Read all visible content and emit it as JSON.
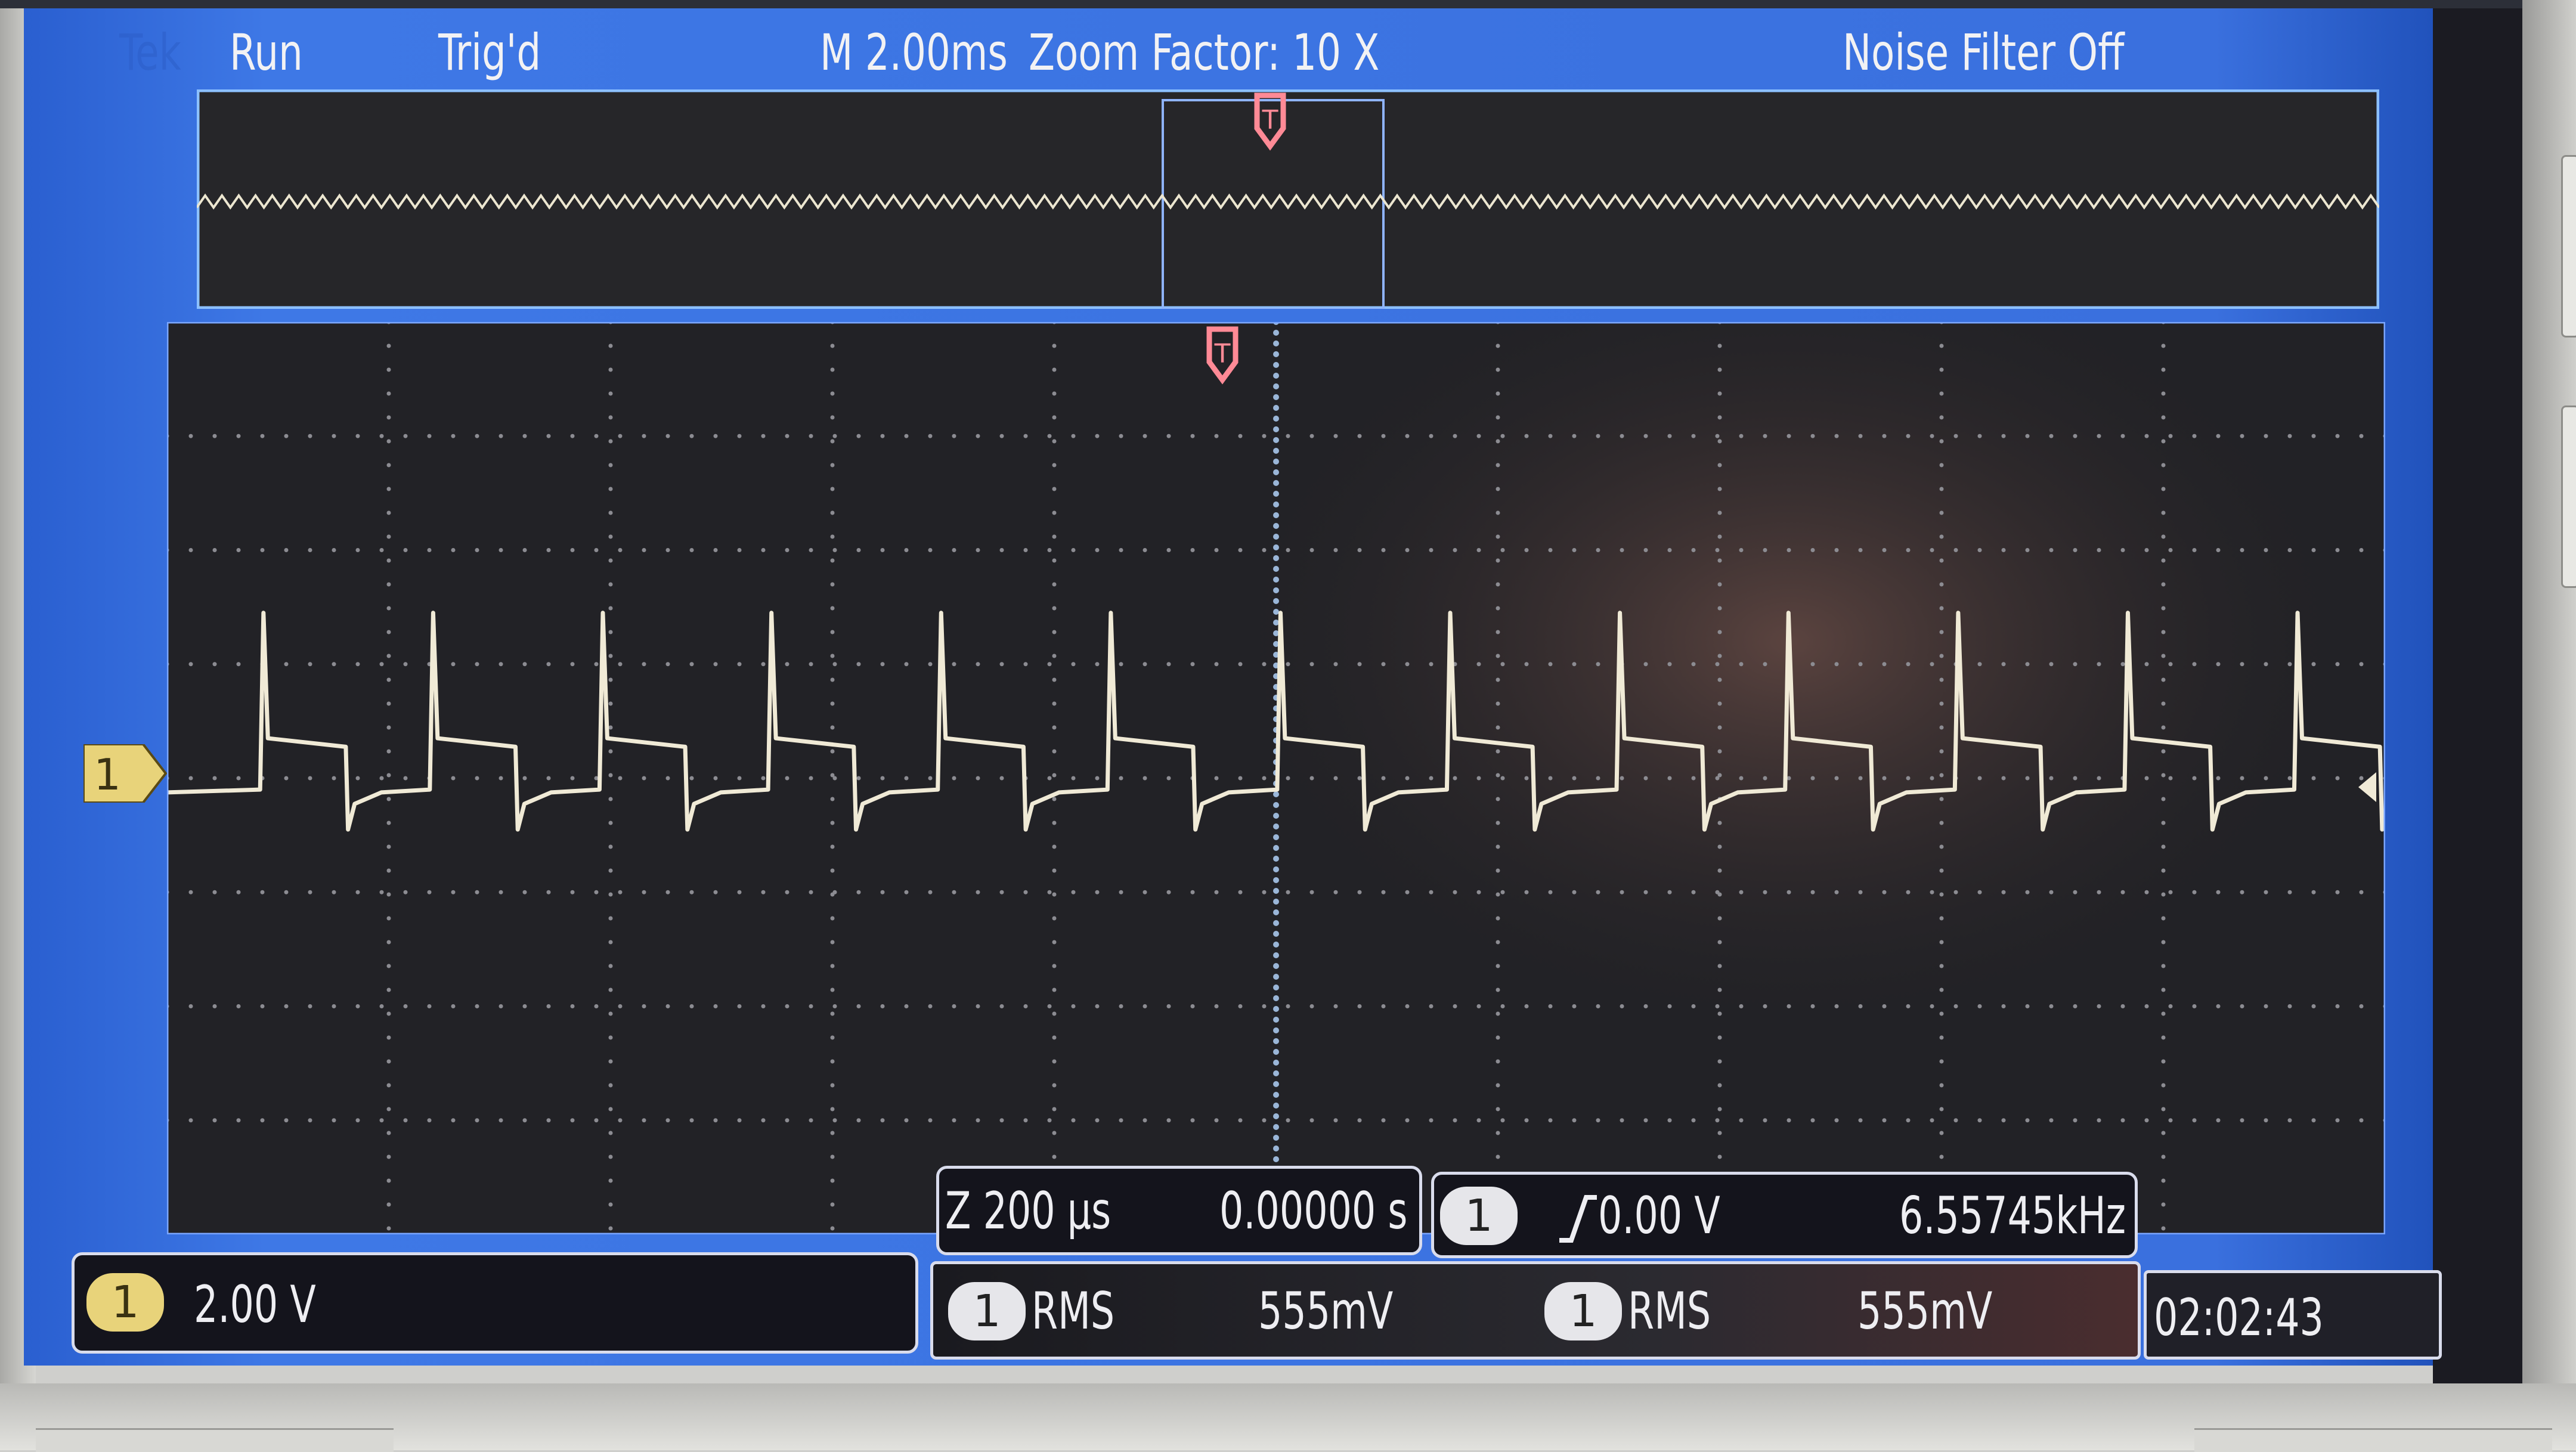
{
  "status_bar": {
    "brand": "Tek",
    "acq_state": "Run",
    "trigger_state": "Trig'd",
    "timebase": "M 2.00ms",
    "zoom": "Zoom Factor: 10 X",
    "noise_filter": "Noise Filter Off"
  },
  "channel1": {
    "marker": "1",
    "scale": "2.00 V",
    "trace_color": "#f0ead6"
  },
  "zoom_readout": {
    "scale": "Z 200 µs",
    "position": "0.00000 s"
  },
  "trigger_readout": {
    "source": "1",
    "slope_icon": "rising-edge-icon",
    "level": "0.00 V",
    "frequency": "6.55745kHz"
  },
  "measurements": [
    {
      "source": "1",
      "type": "RMS",
      "value": "555mV"
    },
    {
      "source": "1",
      "type": "RMS",
      "value": "555mV"
    }
  ],
  "clock": "02:02:43",
  "colors": {
    "screen_blue": "#3a70de",
    "graticule_bg": "#1f1f24",
    "trigger_marker": "#ff7f8c",
    "badge_yellow": "#e8d37a",
    "badge_white": "#e6e6ea",
    "readout_bg": "#14141c"
  },
  "chart_data": {
    "type": "line",
    "title": "",
    "xlabel": "",
    "ylabel": "",
    "grid": true,
    "xlim": [
      -1.0,
      1.0
    ],
    "x_unit": "ms",
    "ylim": [
      -8.0,
      8.0
    ],
    "y_unit": "V",
    "series": [
      {
        "waveform": "periodic pulse with spike on rising edge",
        "period_ms": 0.1525,
        "rising_edge_x_ms": [
          -0.913,
          -0.76,
          -0.607,
          -0.455,
          -0.302,
          -0.149,
          0.004,
          0.157,
          0.31,
          0.462,
          0.615,
          0.768,
          0.921
        ],
        "high_level_v": 0.55,
        "low_level_v": -0.25,
        "spike_peak_v": 2.9,
        "dip_v": -0.9
      }
    ]
  }
}
